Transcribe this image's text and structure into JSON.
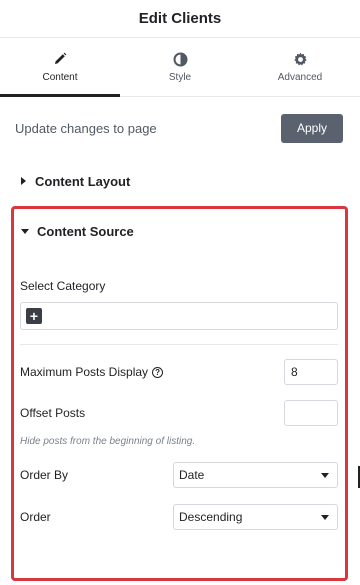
{
  "header": {
    "title": "Edit Clients"
  },
  "tabs": [
    {
      "label": "Content",
      "icon": "pencil-icon",
      "active": true
    },
    {
      "label": "Style",
      "icon": "contrast-icon",
      "active": false
    },
    {
      "label": "Advanced",
      "icon": "gear-icon",
      "active": false
    }
  ],
  "update": {
    "text": "Update changes to page",
    "button": "Apply"
  },
  "sections": {
    "content_layout": {
      "label": "Content Layout",
      "expanded": false
    },
    "content_source": {
      "label": "Content Source",
      "expanded": true
    }
  },
  "fields": {
    "category": {
      "label": "Select Category",
      "add": "+"
    },
    "max_posts": {
      "label": "Maximum Posts Display",
      "help": "?",
      "value": "8"
    },
    "offset": {
      "label": "Offset Posts",
      "value": "",
      "hint": "Hide posts from the beginning of listing."
    },
    "order_by": {
      "label": "Order By",
      "value": "Date"
    },
    "order": {
      "label": "Order",
      "value": "Descending"
    }
  },
  "colors": {
    "highlight": "#d9373f",
    "apply_button": "#5a6270"
  }
}
